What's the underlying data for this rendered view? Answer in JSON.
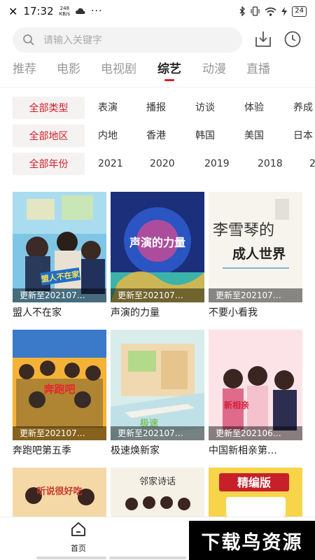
{
  "status_bar": {
    "close": "✕",
    "time": "17:32",
    "net_speed_value": "248",
    "net_speed_unit": "KB/s",
    "more": "···",
    "battery": "24"
  },
  "search": {
    "placeholder": "请输入关键字"
  },
  "tabs": [
    {
      "label": "推荐"
    },
    {
      "label": "电影"
    },
    {
      "label": "电视剧"
    },
    {
      "label": "综艺",
      "active": true
    },
    {
      "label": "动漫"
    },
    {
      "label": "直播"
    }
  ],
  "filters": {
    "type": {
      "tag": "全部类型",
      "options": [
        "表演",
        "播报",
        "访谈",
        "体验",
        "养成"
      ]
    },
    "region": {
      "tag": "全部地区",
      "options": [
        "内地",
        "香港",
        "韩国",
        "美国",
        "日本"
      ]
    },
    "year": {
      "tag": "全部年份",
      "options": [
        "2021",
        "2020",
        "2019",
        "2018",
        "2"
      ]
    }
  },
  "cards": [
    {
      "title": "盟人不在家",
      "update": "更新至202107…",
      "poster_text": "盟人不在家"
    },
    {
      "title": "声演的力量",
      "update": "更新至202107…",
      "poster_text": "声演的力量"
    },
    {
      "title": "不要小看我",
      "update": "更新至202107…",
      "poster_line1": "李雪琴的",
      "poster_line2": "成人世界"
    },
    {
      "title": "奔跑吧第五季",
      "update": "更新至202107…",
      "poster_text": "奔跑吧"
    },
    {
      "title": "极速焕新家",
      "update": "更新至202107…",
      "poster_text": "极速"
    },
    {
      "title": "中国新相亲第…",
      "update": "更新至202106…",
      "poster_text": "新相亲"
    },
    {
      "title": "",
      "update": "",
      "poster_text": "听说很好吃"
    },
    {
      "title": "",
      "update": "",
      "poster_text": "邻家诗话"
    },
    {
      "title": "",
      "update": "",
      "poster_text": "精编版"
    }
  ],
  "bottom_nav": {
    "home_label": "首页"
  },
  "watermark": "下载鸟资源",
  "colors": {
    "accent": "#d4202a",
    "tag_bg": "#f5f2f2",
    "search_bg": "#f3f3f3"
  }
}
